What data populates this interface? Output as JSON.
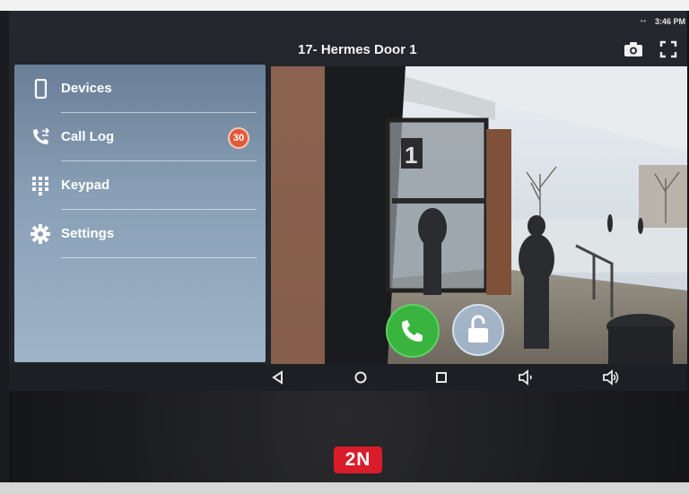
{
  "status_bar": {
    "indicator_icon": "sync-arrows-icon",
    "time": "3:46 PM"
  },
  "title_bar": {
    "title": "17- Hermes Door 1",
    "camera_button_icon": "camera-icon",
    "fullscreen_button_icon": "fullscreen-icon"
  },
  "sidebar": {
    "items": [
      {
        "label": "Devices",
        "icon": "device-icon"
      },
      {
        "label": "Call Log",
        "icon": "call-log-icon",
        "badge": "30"
      },
      {
        "label": "Keypad",
        "icon": "keypad-icon"
      },
      {
        "label": "Settings",
        "icon": "gear-icon"
      }
    ]
  },
  "camera": {
    "call_button_icon": "phone-icon",
    "unlock_button_icon": "unlock-icon",
    "call_button_color": "#39b43e"
  },
  "nav_bar": {
    "buttons": [
      "back-icon",
      "home-icon",
      "recents-icon",
      "volume-down-icon",
      "volume-up-icon"
    ]
  },
  "device": {
    "logo_text": "2N",
    "logo_color": "#d81c2a"
  },
  "colors": {
    "menu_bg": "#8aa0b6",
    "badge": "#e05a3a",
    "unlock": "#aabed7"
  }
}
